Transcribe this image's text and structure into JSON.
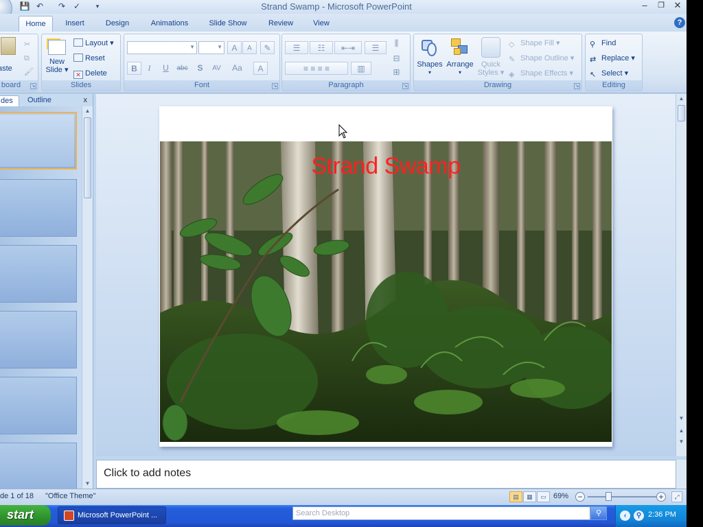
{
  "window": {
    "title": "Strand Swamp - Microsoft PowerPoint",
    "minimize": "–",
    "restore": "❐",
    "close": "✕"
  },
  "qat": {
    "save": "💾",
    "undo": "↶",
    "redo": "↷",
    "spell": "✓",
    "more": "▾"
  },
  "tabs": [
    {
      "label": "Home",
      "active": true
    },
    {
      "label": "Insert"
    },
    {
      "label": "Design"
    },
    {
      "label": "Animations"
    },
    {
      "label": "Slide Show"
    },
    {
      "label": "Review"
    },
    {
      "label": "View"
    }
  ],
  "help": "?",
  "ribbon": {
    "clipboard": {
      "label": "board",
      "paste": "aste"
    },
    "slides": {
      "label": "Slides",
      "new_slide": "New",
      "new_slide2": "Slide ▾",
      "layout": "Layout ▾",
      "reset": "Reset",
      "delete": "Delete"
    },
    "font": {
      "label": "Font",
      "grow": "A",
      "shrink": "A",
      "clear": "✎",
      "bold": "B",
      "italic": "I",
      "underline": "U",
      "strike": "abc",
      "shadow": "S",
      "spacing": "AV",
      "case": "Aa",
      "color": "A"
    },
    "paragraph": {
      "label": "Paragraph"
    },
    "drawing": {
      "label": "Drawing",
      "shapes": "Shapes",
      "arrange": "Arrange",
      "quick": "Quick",
      "quick2": "Styles ▾",
      "fill": "Shape Fill ▾",
      "outline": "Shape Outline ▾",
      "effects": "Shape Effects ▾"
    },
    "editing": {
      "label": "Editing",
      "find": "Find",
      "replace": "Replace ▾",
      "select": "Select ▾"
    }
  },
  "panel": {
    "tab_slides": "des",
    "tab_outline": "Outline",
    "close": "x"
  },
  "slide": {
    "title": "Strand Swamp"
  },
  "notes": {
    "placeholder": "Click to add notes"
  },
  "status": {
    "slide_info": "de 1 of 18",
    "theme": "\"Office Theme\"",
    "zoom": "69%",
    "zoom_out": "−",
    "zoom_in": "+"
  },
  "taskbar": {
    "start": "start",
    "item": "Microsoft PowerPoint ...",
    "search_placeholder": "Search Desktop",
    "clock": "2:36 PM"
  },
  "colors": {
    "accent": "#15428b",
    "title_red": "#ff2020",
    "taskbar": "#245edc"
  }
}
